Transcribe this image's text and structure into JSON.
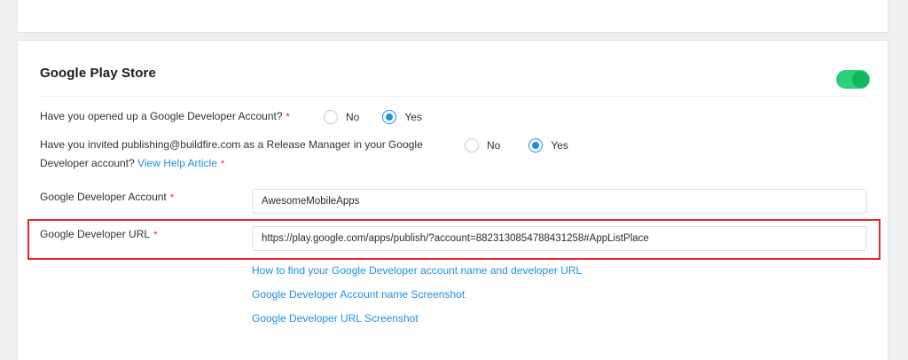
{
  "section": {
    "title": "Google Play Store",
    "enabled": true
  },
  "questions": [
    {
      "text": "Have you opened up a Google Developer Account?",
      "required_mark": "*",
      "options": [
        {
          "label": "No",
          "selected": false
        },
        {
          "label": "Yes",
          "selected": true
        }
      ]
    },
    {
      "text_line1": "Have you invited publishing@buildfire.com as a Release Manager in your Google",
      "text_line2": "Developer account?",
      "help_link": "View Help Article",
      "required_mark": "*",
      "options": [
        {
          "label": "No",
          "selected": false
        },
        {
          "label": "Yes",
          "selected": true
        }
      ]
    }
  ],
  "fields": {
    "account": {
      "label": "Google Developer Account",
      "required_mark": "*",
      "value": "AwesomeMobileApps"
    },
    "url": {
      "label": "Google Developer URL",
      "required_mark": "*",
      "value": "https://play.google.com/apps/publish/?account=8823130854788431258#AppListPlace"
    }
  },
  "help_links": [
    "How to find your Google Developer account name and developer URL",
    "Google Developer Account name Screenshot",
    "Google Developer URL Screenshot"
  ],
  "colors": {
    "accent": "#1f8fe0",
    "toggle_on": "#0fb85e",
    "required": "#e0242b",
    "highlight": "#e4252a"
  }
}
